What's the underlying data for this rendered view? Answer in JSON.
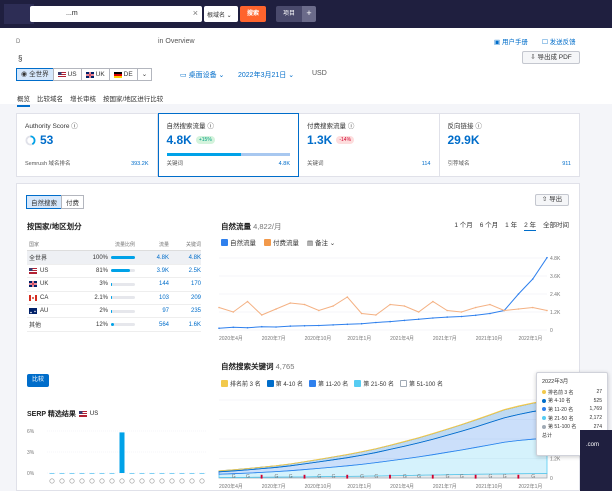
{
  "topbar": {
    "search_value": "...m",
    "domain_select": "根域名 ⌄",
    "search_label": "搜索",
    "project_label": "项目",
    "plus_label": "+"
  },
  "header": {
    "crumb": "D",
    "title_partial": "in Overview",
    "title_glyph": "§",
    "manual": "用户手册",
    "feedback": "发送反馈",
    "export_pdf": "导出成 PDF",
    "db": [
      {
        "label": "全世界",
        "active": true
      },
      {
        "label": "US"
      },
      {
        "label": "UK"
      },
      {
        "label": "DE"
      }
    ],
    "more_caret": "⌄",
    "device": "桌面设备",
    "date": "2022年3月21日",
    "currency": "USD",
    "tabs": [
      "概览",
      "比较域名",
      "增长审核",
      "按国家/地区进行比较"
    ]
  },
  "kpis": [
    {
      "label": "Authority Score",
      "value": "53",
      "sub": "Semrush 域名排名",
      "subval": "393.2K"
    },
    {
      "label": "自然搜索流量",
      "value": "4.8K",
      "badge": "+15%",
      "sub": "关键词",
      "subval": "4.8K"
    },
    {
      "label": "付费搜索流量",
      "value": "1.3K",
      "badge": "-14%",
      "sub": "关键词",
      "subval": "114"
    },
    {
      "label": "反向链接",
      "value": "29.9K",
      "sub": "引荐域名",
      "subval": "911"
    }
  ],
  "main": {
    "seg": [
      "自然搜索",
      "付费"
    ],
    "export": "导出",
    "country_title": "按国家/地区划分",
    "table_head": [
      "国家",
      "流量比例",
      "流量",
      "关键词"
    ],
    "rows": [
      {
        "name": "全世界",
        "share": "100%",
        "traffic": "4.8K",
        "kw": "4.8K",
        "pct": 100,
        "flag": "none",
        "sel": true
      },
      {
        "name": "US",
        "share": "81%",
        "traffic": "3.9K",
        "kw": "2.5K",
        "pct": 81,
        "flag": "us"
      },
      {
        "name": "UK",
        "share": "3%",
        "traffic": "144",
        "kw": "170",
        "pct": 3,
        "flag": "uk"
      },
      {
        "name": "CA",
        "share": "2.1%",
        "traffic": "103",
        "kw": "209",
        "pct": 2.1,
        "flag": "ca"
      },
      {
        "name": "AU",
        "share": "2%",
        "traffic": "97",
        "kw": "235",
        "pct": 2,
        "flag": "au"
      },
      {
        "name": "其他",
        "share": "12%",
        "traffic": "564",
        "kw": "1.6K",
        "pct": 12,
        "flag": "none"
      }
    ],
    "compare": "比较",
    "serp_title": "SERP 精选结果",
    "serp_db": "US",
    "traffic_title": "自然流量",
    "traffic_count": "4,822/月",
    "legend_organic": "自然流量",
    "legend_paid": "付费流量",
    "notes": "备注",
    "time_tabs": [
      "1 个月",
      "6 个月",
      "1 年",
      "2 年",
      "全部时间"
    ],
    "kw_title": "自然搜索关键词",
    "kw_count": "4,765",
    "kw_legend": [
      "排名前 3 名",
      "第 4-10 名",
      "第 11-20 名",
      "第 21-50 名",
      "第 51-100 名"
    ]
  },
  "tooltip": {
    "title": "2022年3月",
    "rows": [
      {
        "label": "排名前 3 名",
        "value": "27",
        "color": "#f2c94c"
      },
      {
        "label": "第 4-10 名",
        "value": "525",
        "color": "#006dca"
      },
      {
        "label": "第 11-20 名",
        "value": "1,769",
        "color": "#2f80ed"
      },
      {
        "label": "第 21-50 名",
        "value": "2,172",
        "color": "#56ccf2"
      },
      {
        "label": "第 51-100 名",
        "value": "274",
        "color": "#a0aab5"
      },
      {
        "label": "总计",
        "value": "4,765",
        "color": "none"
      }
    ]
  },
  "corner": ".com",
  "chart_data": [
    {
      "type": "line",
      "xlabel": "",
      "ylabel": "",
      "ylim": [
        0,
        4800
      ],
      "yticks": [
        "4.8K",
        "3.6K",
        "2.4K",
        "1.2K",
        "0"
      ],
      "xticks": [
        "2020年4月",
        "2020年7月",
        "2020年10月",
        "2021年1月",
        "2021年4月",
        "2021年7月",
        "2021年10月",
        "2022年1月"
      ],
      "x": [
        0,
        1,
        2,
        3,
        4,
        5,
        6,
        7,
        8,
        9,
        10,
        11,
        12,
        13,
        14,
        15,
        16,
        17,
        18,
        19,
        20,
        21,
        22,
        23
      ],
      "series": [
        {
          "name": "自然流量",
          "color": "#2f80ed",
          "values": [
            120,
            180,
            150,
            220,
            200,
            260,
            280,
            300,
            340,
            380,
            420,
            500,
            560,
            640,
            720,
            800,
            860,
            900,
            980,
            1100,
            1300,
            2400,
            3400,
            4822
          ]
        },
        {
          "name": "付费流量",
          "color": "#f4b183",
          "values": [
            1500,
            1200,
            1900,
            1000,
            1400,
            1800,
            1700,
            1300,
            1600,
            2200,
            1100,
            1000,
            1700,
            1600,
            1200,
            1900,
            1300,
            1200,
            1500,
            1700,
            1300,
            1400,
            1500,
            1300
          ]
        }
      ]
    },
    {
      "type": "area",
      "xlabel": "",
      "ylabel": "",
      "ylim": [
        0,
        4800
      ],
      "yticks": [
        "4.8K",
        "3.6K",
        "2.4K",
        "1.2K",
        "0"
      ],
      "xticks": [
        "2020年4月",
        "2020年7月",
        "2020年10月",
        "2021年1月",
        "2021年4月",
        "2021年7月",
        "2021年10月",
        "2022年1月"
      ],
      "x": [
        0,
        1,
        2,
        3,
        4,
        5,
        6,
        7,
        8,
        9,
        10,
        11,
        12,
        13,
        14,
        15,
        16,
        17,
        18,
        19,
        20,
        21,
        22,
        23
      ],
      "series": [
        {
          "name": "排名前 3 名",
          "color": "#f2c94c",
          "values": [
            5,
            5,
            6,
            6,
            7,
            8,
            8,
            9,
            10,
            11,
            12,
            13,
            14,
            15,
            16,
            17,
            18,
            19,
            20,
            21,
            22,
            24,
            25,
            27
          ]
        },
        {
          "name": "第 4-10 名",
          "color": "#006dca",
          "values": [
            60,
            70,
            80,
            90,
            100,
            110,
            130,
            150,
            170,
            190,
            210,
            230,
            250,
            280,
            310,
            340,
            370,
            400,
            430,
            460,
            490,
            500,
            510,
            525
          ]
        },
        {
          "name": "第 11-20 名",
          "color": "#2f80ed",
          "values": [
            150,
            170,
            200,
            230,
            260,
            300,
            350,
            400,
            450,
            500,
            560,
            620,
            700,
            780,
            860,
            950,
            1050,
            1150,
            1260,
            1380,
            1500,
            1600,
            1700,
            1769
          ]
        },
        {
          "name": "第 21-50 名",
          "color": "#56ccf2",
          "values": [
            200,
            230,
            260,
            300,
            340,
            390,
            450,
            510,
            580,
            650,
            730,
            820,
            920,
            1020,
            1130,
            1250,
            1380,
            1510,
            1650,
            1800,
            1950,
            2050,
            2120,
            2172
          ]
        },
        {
          "name": "第 51-100 名",
          "color": "#a0aab5",
          "values": [
            30,
            35,
            40,
            45,
            50,
            60,
            70,
            80,
            90,
            100,
            110,
            125,
            140,
            155,
            170,
            185,
            200,
            215,
            230,
            240,
            250,
            260,
            268,
            274
          ]
        }
      ]
    },
    {
      "type": "bar",
      "ylim": [
        0,
        6
      ],
      "yticks": [
        "6%",
        "3%",
        "0%"
      ],
      "categories": [
        "f1",
        "f2",
        "f3",
        "f4",
        "f5",
        "f6",
        "f7",
        "f8",
        "f9",
        "f10",
        "f11",
        "f12",
        "f13",
        "f14",
        "f15",
        "f16"
      ],
      "values": [
        0,
        0,
        0,
        0,
        0,
        0,
        0,
        5.8,
        0,
        0,
        0,
        0,
        0,
        0,
        0,
        0
      ]
    }
  ]
}
